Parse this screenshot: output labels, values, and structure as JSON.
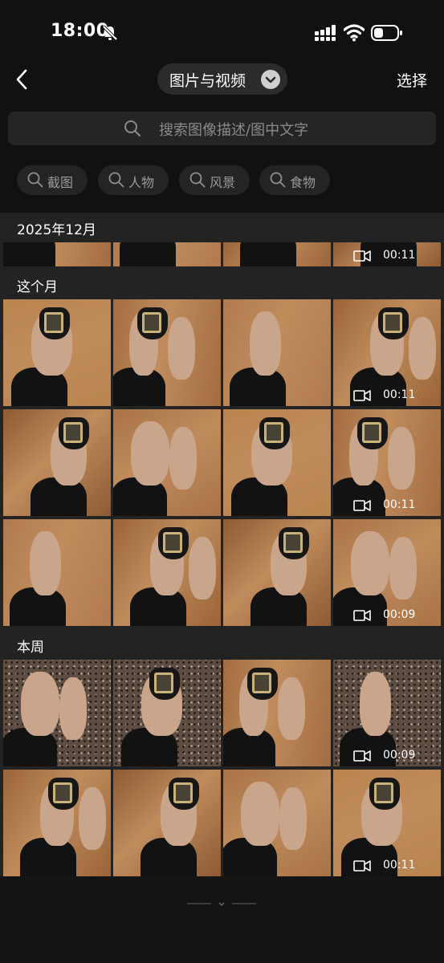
{
  "status_bar": {
    "time": "18:00",
    "icons": [
      "bell-muted-icon",
      "cellular-signal-icon",
      "wifi-icon",
      "battery-icon"
    ]
  },
  "header": {
    "back_icon": "chevron-left-icon",
    "title": "图片与视频",
    "title_dropdown_icon": "chevron-down-icon",
    "select_label": "选择"
  },
  "search": {
    "icon": "search-icon",
    "placeholder": "搜索图像描述/图中文字"
  },
  "filters": [
    {
      "label": "截图",
      "icon": "search-icon"
    },
    {
      "label": "人物",
      "icon": "search-icon"
    },
    {
      "label": "风景",
      "icon": "search-icon"
    },
    {
      "label": "食物",
      "icon": "search-icon"
    }
  ],
  "sections": [
    {
      "title": "2025年12月",
      "items": [
        {
          "kind": "photo"
        },
        {
          "kind": "photo"
        },
        {
          "kind": "photo"
        },
        {
          "kind": "video",
          "duration": "00:11"
        }
      ]
    },
    {
      "title": "这个月",
      "items": [
        {
          "kind": "photo"
        },
        {
          "kind": "photo"
        },
        {
          "kind": "photo"
        },
        {
          "kind": "video",
          "duration": "00:11"
        },
        {
          "kind": "photo"
        },
        {
          "kind": "photo"
        },
        {
          "kind": "photo"
        },
        {
          "kind": "video",
          "duration": "00:11"
        },
        {
          "kind": "photo"
        },
        {
          "kind": "photo"
        },
        {
          "kind": "photo"
        },
        {
          "kind": "video",
          "duration": "00:09"
        }
      ]
    },
    {
      "title": "本周",
      "items": [
        {
          "kind": "photo"
        },
        {
          "kind": "photo"
        },
        {
          "kind": "photo"
        },
        {
          "kind": "video",
          "duration": "00:09"
        },
        {
          "kind": "photo"
        },
        {
          "kind": "photo"
        },
        {
          "kind": "photo"
        },
        {
          "kind": "video",
          "duration": "00:11"
        }
      ]
    }
  ],
  "colors": {
    "background": "#111111",
    "section_background": "#232323",
    "chip_background": "#242424",
    "wood_floor": "#a8754a",
    "terrazzo_floor": "#5a4a40"
  }
}
